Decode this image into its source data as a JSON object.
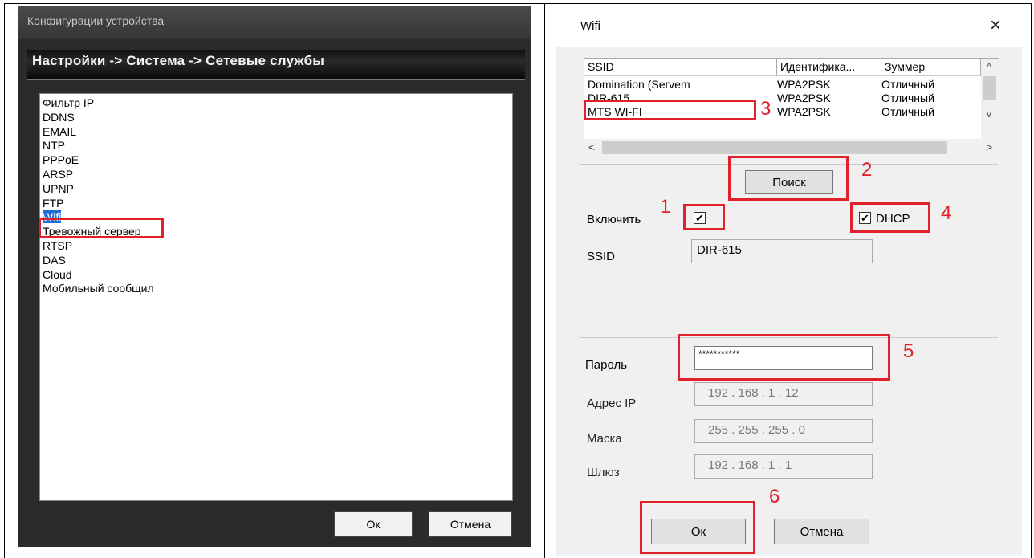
{
  "left_window": {
    "title": "Конфигурации устройства",
    "breadcrumb": "Настройки -> Система -> Сетевые службы",
    "services": [
      "Фильтр IP",
      "DDNS",
      "EMAIL",
      "NTP",
      "PPPoE",
      "ARSP",
      "UPNP",
      "FTP",
      "Wifi",
      "Тревожный сервер",
      "RTSP",
      "DAS",
      "Cloud",
      "Мобильный сообщил"
    ],
    "selected_service": "Wifi",
    "ok_label": "Ок",
    "cancel_label": "Отмена"
  },
  "wifi_dialog": {
    "title": "Wifi",
    "close_glyph": "×",
    "table": {
      "headers": [
        "SSID",
        "Идентифика...",
        "Зуммер"
      ],
      "rows": [
        [
          "Domination (Servem",
          "WPA2PSK",
          "Отличный"
        ],
        [
          "DIR-615",
          "WPA2PSK",
          "Отличный"
        ],
        [
          "MTS WI-FI",
          "WPA2PSK",
          "Отличный"
        ]
      ],
      "scroll_up": "^",
      "scroll_down": "v",
      "scroll_left": "<",
      "scroll_right": ">"
    },
    "search_label": "Поиск",
    "enable_label": "Включить",
    "enable_checked": true,
    "dhcp_label": "DHCP",
    "dhcp_checked": true,
    "check_glyph": "✔",
    "ssid_label": "SSID",
    "ssid_value": "DIR-615",
    "password_label": "Пароль",
    "password_value": "***********",
    "ip_label": "Адрес IP",
    "ip_value": "192 . 168 . 1 . 12",
    "mask_label": "Маска",
    "mask_value": "255 . 255 . 255 . 0",
    "gateway_label": "Шлюз",
    "gateway_value": "192 . 168 . 1 . 1",
    "ok_label": "Ок",
    "cancel_label": "Отмена"
  },
  "annotations": [
    "1",
    "2",
    "3",
    "4",
    "5",
    "6"
  ],
  "colors": {
    "annotation_red": "#e0202a",
    "selection_blue": "#1e6fd9"
  }
}
